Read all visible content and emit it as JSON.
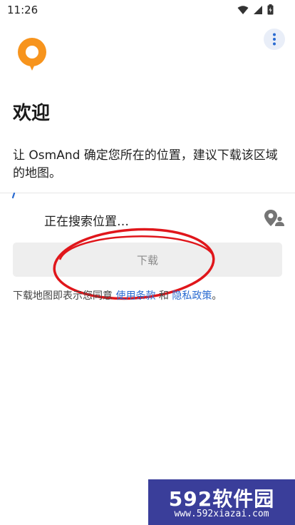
{
  "status_bar": {
    "time": "11:26",
    "icons": [
      "wifi-icon",
      "signal-icon",
      "battery-icon"
    ]
  },
  "header": {
    "menu_icon": "more-vertical-icon",
    "logo_icon": "osmand-map-pin-logo",
    "title": "欢迎"
  },
  "main": {
    "description": "让 OsmAnd 确定您所在的位置，建议下载该区域的地图。",
    "searching_label": "正在搜索位置…",
    "location_icon": "location-person-icon",
    "download_label": "下载",
    "terms": {
      "prefix": "下载地图即表示您同意",
      "terms_link": "使用条款",
      "joiner": "和",
      "privacy_link": "隐私政策",
      "suffix": "。"
    }
  },
  "watermark": {
    "brand": "592软件园",
    "url": "www.592xiazai.com"
  },
  "colors": {
    "accent_orange": "#f7941d",
    "link_blue": "#2a6bd1",
    "annotation_red": "#e0161b",
    "watermark_bg": "#3a3e9a"
  }
}
